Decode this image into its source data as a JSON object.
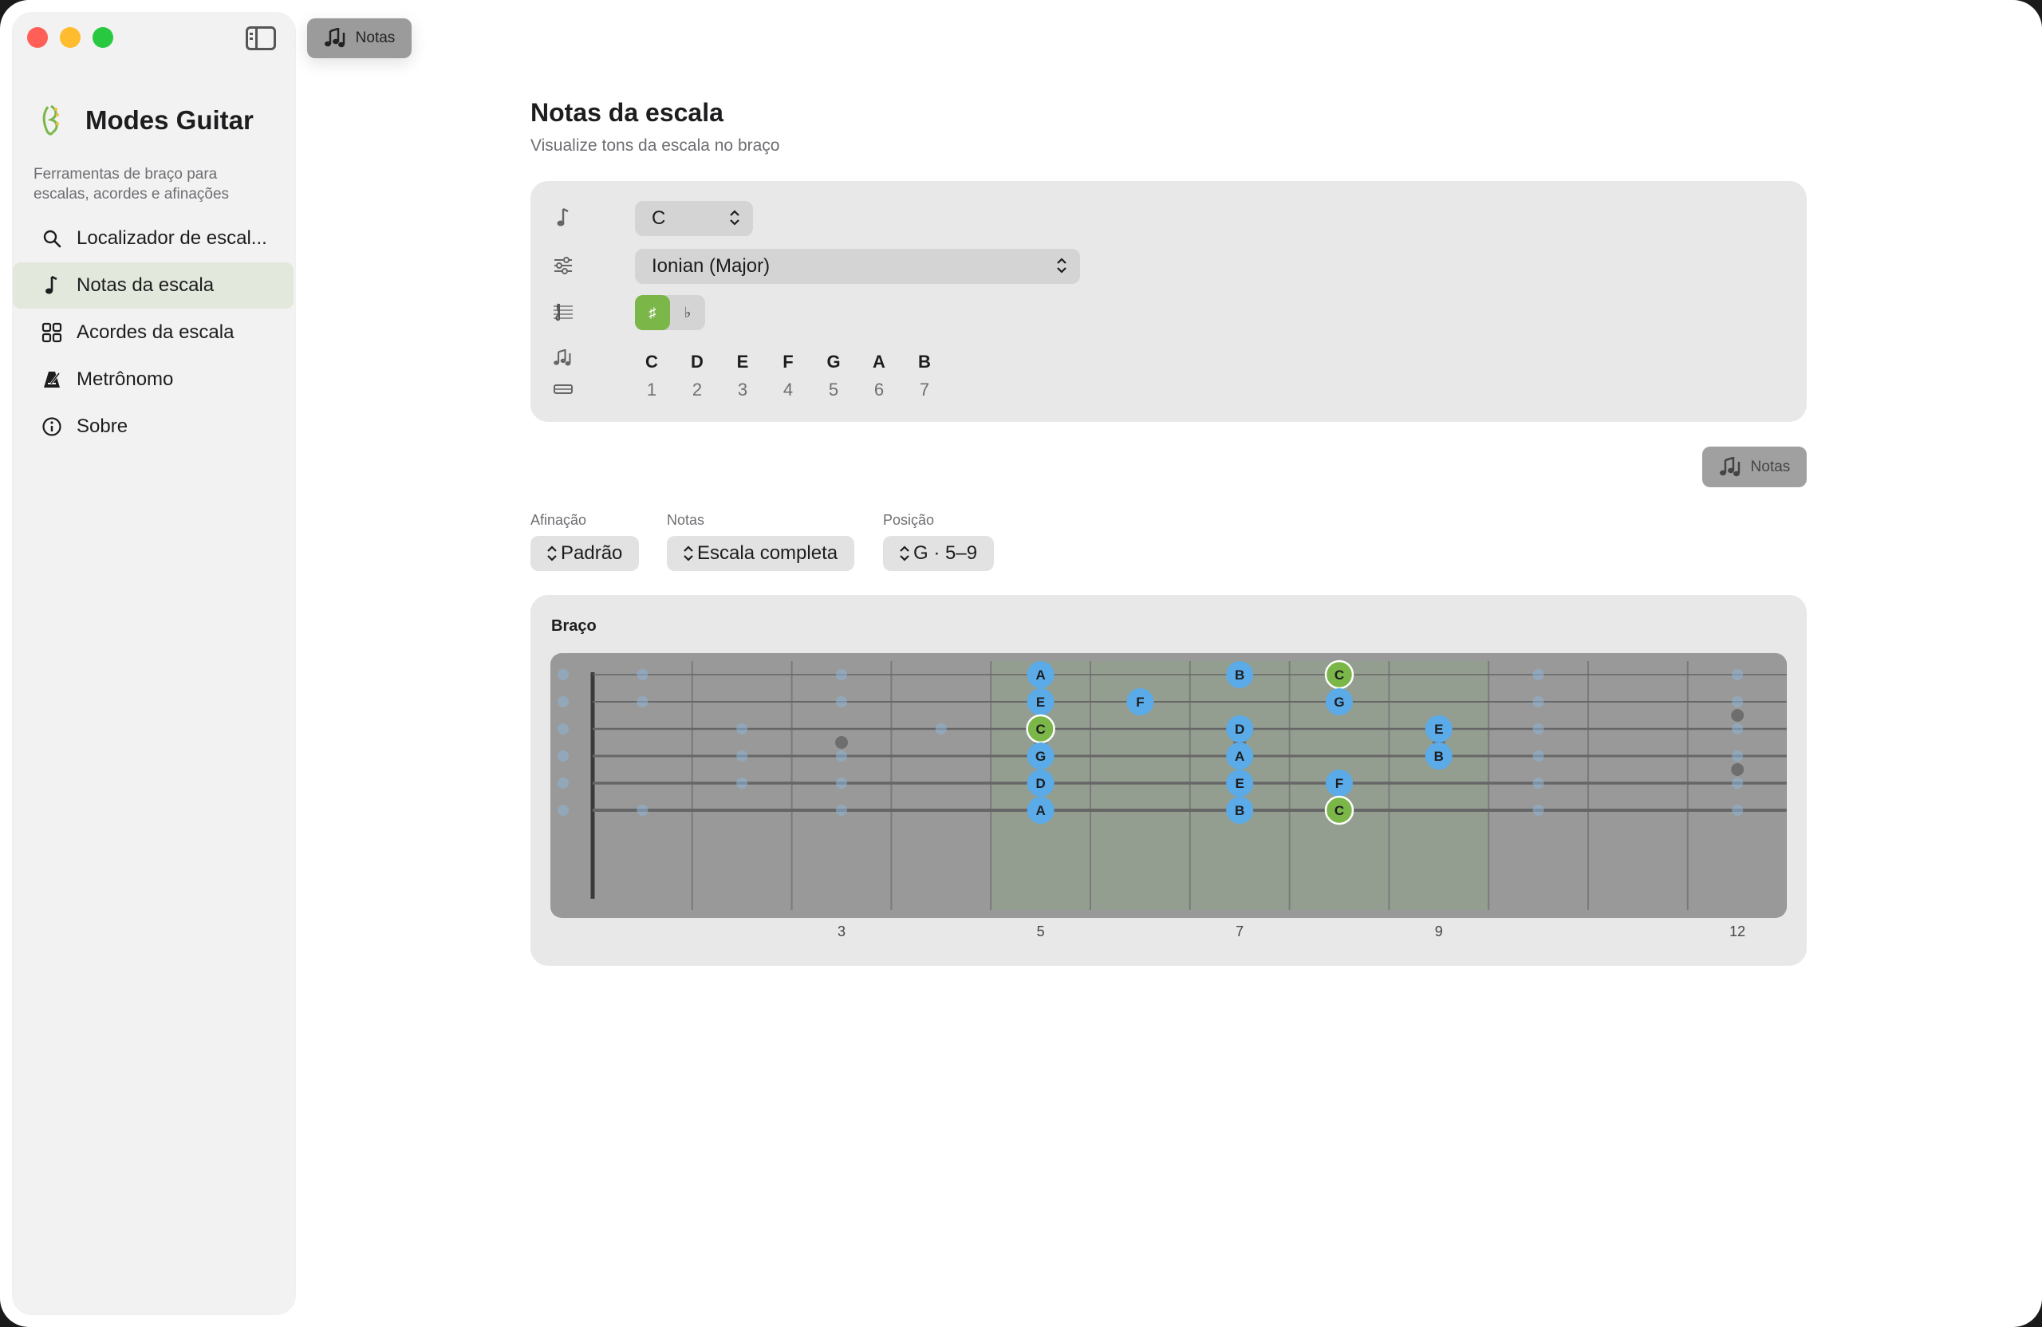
{
  "window": {
    "traffic_colors": [
      "#ff5f57",
      "#febc2e",
      "#28c840"
    ]
  },
  "toolbar": {
    "notes_label": "Notas"
  },
  "sidebar": {
    "app_title": "Modes Guitar",
    "app_desc": "Ferramentas de braço para escalas, acordes e afinações",
    "items": [
      {
        "label": "Localizador de escal...",
        "icon": "search-icon"
      },
      {
        "label": "Notas da escala",
        "icon": "music-note-icon",
        "active": true
      },
      {
        "label": "Acordes da escala",
        "icon": "grid-icon"
      },
      {
        "label": "Metrônomo",
        "icon": "metronome-icon"
      },
      {
        "label": "Sobre",
        "icon": "info-icon"
      }
    ]
  },
  "main": {
    "title": "Notas da escala",
    "subtitle": "Visualize tons da escala no braço",
    "key_select": "C",
    "mode_select": "Ionian (Major)",
    "accidental_sharp": "♯",
    "accidental_flat": "♭",
    "scale_notes": [
      "C",
      "D",
      "E",
      "F",
      "G",
      "A",
      "B"
    ],
    "scale_degrees": [
      "1",
      "2",
      "3",
      "4",
      "5",
      "6",
      "7"
    ],
    "notes_button": "Notas",
    "controls": {
      "tuning_label": "Afinação",
      "tuning_value": "Padrão",
      "notes_label": "Notas",
      "notes_value": "Escala completa",
      "position_label": "Posição",
      "position_value": "G · 5–9"
    },
    "fretboard": {
      "title": "Braço",
      "fret_numbers": [
        "3",
        "5",
        "7",
        "9",
        "12"
      ],
      "highlight_frets": [
        5,
        9
      ],
      "inlay_frets": [
        3,
        5,
        7,
        9,
        12
      ],
      "root_color": "#7ab648",
      "note_color": "#5aabe8",
      "notes": [
        {
          "string": 1,
          "fret": 5,
          "note": "A"
        },
        {
          "string": 1,
          "fret": 7,
          "note": "B"
        },
        {
          "string": 1,
          "fret": 8,
          "note": "C",
          "root": true
        },
        {
          "string": 2,
          "fret": 5,
          "note": "E"
        },
        {
          "string": 2,
          "fret": 6,
          "note": "F"
        },
        {
          "string": 2,
          "fret": 8,
          "note": "G"
        },
        {
          "string": 3,
          "fret": 5,
          "note": "C",
          "root": true
        },
        {
          "string": 3,
          "fret": 7,
          "note": "D"
        },
        {
          "string": 3,
          "fret": 9,
          "note": "E"
        },
        {
          "string": 4,
          "fret": 5,
          "note": "G"
        },
        {
          "string": 4,
          "fret": 7,
          "note": "A"
        },
        {
          "string": 4,
          "fret": 9,
          "note": "B"
        },
        {
          "string": 5,
          "fret": 5,
          "note": "D"
        },
        {
          "string": 5,
          "fret": 7,
          "note": "E"
        },
        {
          "string": 5,
          "fret": 8,
          "note": "F"
        },
        {
          "string": 6,
          "fret": 5,
          "note": "A"
        },
        {
          "string": 6,
          "fret": 7,
          "note": "B"
        },
        {
          "string": 6,
          "fret": 8,
          "note": "C",
          "root": true
        }
      ]
    }
  }
}
